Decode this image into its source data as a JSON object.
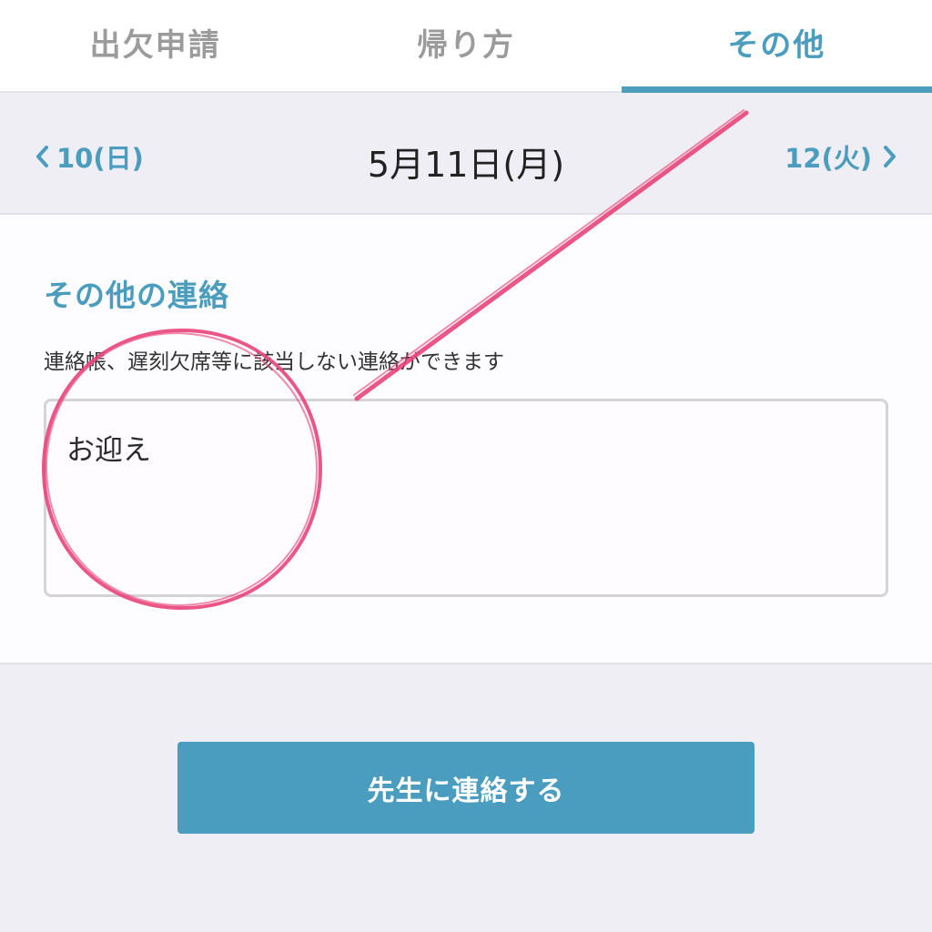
{
  "tabs": [
    {
      "label": "出欠申請",
      "active": false
    },
    {
      "label": "帰り方",
      "active": false
    },
    {
      "label": "その他",
      "active": true
    }
  ],
  "date_nav": {
    "prev_label": "10(日)",
    "current_label": "5月11日(月)",
    "next_label": "12(火)"
  },
  "section": {
    "title": "その他の連絡",
    "description": "連絡帳、遅刻欠席等に該当しない連絡ができます",
    "message_value": "お迎え"
  },
  "submit": {
    "label": "先生に連絡する"
  },
  "colors": {
    "accent": "#4a9dbd",
    "annotation": "#e8457a",
    "background": "#f0eef5"
  }
}
